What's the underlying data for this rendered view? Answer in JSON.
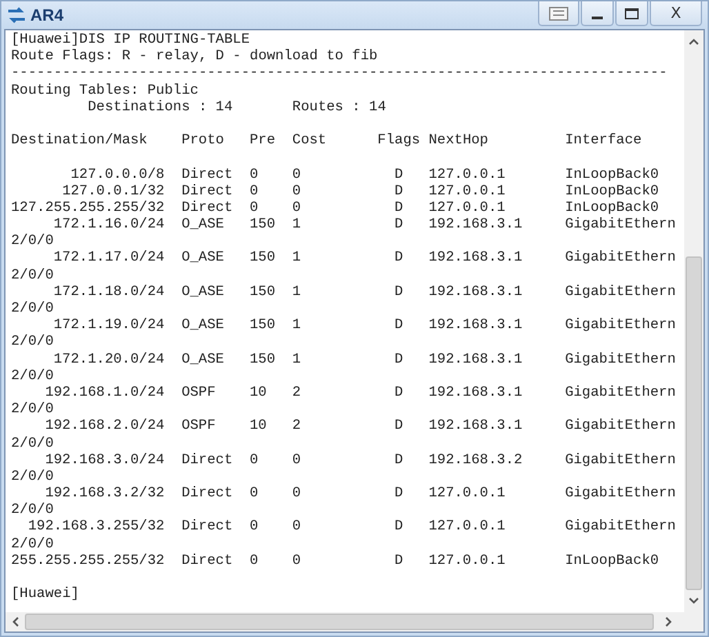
{
  "window": {
    "title": "AR4",
    "controls": [
      {
        "kind": "options"
      },
      {
        "kind": "minimize"
      },
      {
        "kind": "maximize"
      },
      {
        "kind": "close",
        "label": "X"
      }
    ]
  },
  "terminal": {
    "intro": [
      "[Huawei]DIS IP ROUTING-TABLE",
      "Route Flags: R - relay, D - download to fib",
      "-----------------------------------------------------------------------------",
      "Routing Tables: Public"
    ],
    "summary": [
      "Destinations : 14",
      "Routes : 14"
    ],
    "columns": [
      "Destination/Mask",
      "Proto",
      "Pre",
      "Cost",
      "Flags",
      "NextHop",
      "Interface"
    ],
    "routes": [
      {
        "destination": "127.0.0.0/8",
        "proto": "Direct",
        "pre": "0",
        "cost": "0",
        "flags": "D",
        "nexthop": "127.0.0.1",
        "interface": "InLoopBack0"
      },
      {
        "destination": "127.0.0.1/32",
        "proto": "Direct",
        "pre": "0",
        "cost": "0",
        "flags": "D",
        "nexthop": "127.0.0.1",
        "interface": "InLoopBack0"
      },
      {
        "destination": "127.255.255.255/32",
        "proto": "Direct",
        "pre": "0",
        "cost": "0",
        "flags": "D",
        "nexthop": "127.0.0.1",
        "interface": "InLoopBack0"
      },
      {
        "destination": "172.1.16.0/24",
        "proto": "O_ASE",
        "pre": "150",
        "cost": "1",
        "flags": "D",
        "nexthop": "192.168.3.1",
        "interface": "GigabitEthern",
        "continuation": "2/0/0"
      },
      {
        "destination": "172.1.17.0/24",
        "proto": "O_ASE",
        "pre": "150",
        "cost": "1",
        "flags": "D",
        "nexthop": "192.168.3.1",
        "interface": "GigabitEthern",
        "continuation": "2/0/0"
      },
      {
        "destination": "172.1.18.0/24",
        "proto": "O_ASE",
        "pre": "150",
        "cost": "1",
        "flags": "D",
        "nexthop": "192.168.3.1",
        "interface": "GigabitEthern",
        "continuation": "2/0/0"
      },
      {
        "destination": "172.1.19.0/24",
        "proto": "O_ASE",
        "pre": "150",
        "cost": "1",
        "flags": "D",
        "nexthop": "192.168.3.1",
        "interface": "GigabitEthern",
        "continuation": "2/0/0"
      },
      {
        "destination": "172.1.20.0/24",
        "proto": "O_ASE",
        "pre": "150",
        "cost": "1",
        "flags": "D",
        "nexthop": "192.168.3.1",
        "interface": "GigabitEthern",
        "continuation": "2/0/0"
      },
      {
        "destination": "192.168.1.0/24",
        "proto": "OSPF",
        "pre": "10",
        "cost": "2",
        "flags": "D",
        "nexthop": "192.168.3.1",
        "interface": "GigabitEthern",
        "continuation": "2/0/0"
      },
      {
        "destination": "192.168.2.0/24",
        "proto": "OSPF",
        "pre": "10",
        "cost": "2",
        "flags": "D",
        "nexthop": "192.168.3.1",
        "interface": "GigabitEthern",
        "continuation": "2/0/0"
      },
      {
        "destination": "192.168.3.0/24",
        "proto": "Direct",
        "pre": "0",
        "cost": "0",
        "flags": "D",
        "nexthop": "192.168.3.2",
        "interface": "GigabitEthern",
        "continuation": "2/0/0"
      },
      {
        "destination": "192.168.3.2/32",
        "proto": "Direct",
        "pre": "0",
        "cost": "0",
        "flags": "D",
        "nexthop": "127.0.0.1",
        "interface": "GigabitEthern",
        "continuation": "2/0/0"
      },
      {
        "destination": "192.168.3.255/32",
        "proto": "Direct",
        "pre": "0",
        "cost": "0",
        "flags": "D",
        "nexthop": "127.0.0.1",
        "interface": "GigabitEthern",
        "continuation": "2/0/0"
      },
      {
        "destination": "255.255.255.255/32",
        "proto": "Direct",
        "pre": "0",
        "cost": "0",
        "flags": "D",
        "nexthop": "127.0.0.1",
        "interface": "InLoopBack0"
      }
    ],
    "prompt": "[Huawei]"
  }
}
